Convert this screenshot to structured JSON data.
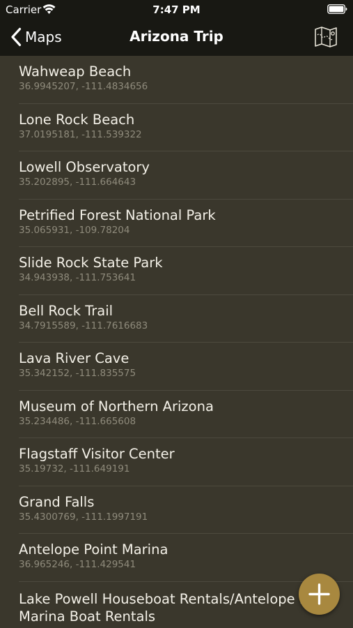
{
  "status_bar": {
    "carrier": "Carrier",
    "time": "7:47 PM",
    "wifi_icon": "wifi-icon",
    "battery_icon": "battery-icon"
  },
  "nav": {
    "back_label": "Maps",
    "title": "Arizona Trip",
    "map_icon": "map-icon"
  },
  "locations": [
    {
      "name": "Wahweap Beach",
      "coords": "36.9945207, -111.4834656"
    },
    {
      "name": "Lone Rock Beach",
      "coords": "37.0195181, -111.539322"
    },
    {
      "name": "Lowell Observatory",
      "coords": "35.202895, -111.664643"
    },
    {
      "name": "Petrified Forest National Park",
      "coords": "35.065931, -109.78204"
    },
    {
      "name": "Slide Rock State Park",
      "coords": "34.943938, -111.753641"
    },
    {
      "name": "Bell Rock Trail",
      "coords": "34.7915589, -111.7616683"
    },
    {
      "name": "Lava River Cave",
      "coords": "35.342152, -111.835575"
    },
    {
      "name": "Museum of Northern Arizona",
      "coords": "35.234486, -111.665608"
    },
    {
      "name": "Flagstaff Visitor Center",
      "coords": "35.19732, -111.649191"
    },
    {
      "name": "Grand Falls",
      "coords": "35.4300769, -111.1997191"
    },
    {
      "name": "Antelope Point Marina",
      "coords": "36.965246, -111.429541"
    },
    {
      "name": "Lake Powell Houseboat Rentals/Antelope Point Marina Boat Rentals",
      "coords": ""
    }
  ],
  "add_button": {
    "icon": "plus-icon"
  },
  "colors": {
    "background": "#3a372c",
    "header": "#181813",
    "accent": "#a8883f",
    "title_text": "#f4f1e8",
    "subtitle_text": "#8f8b7c"
  }
}
